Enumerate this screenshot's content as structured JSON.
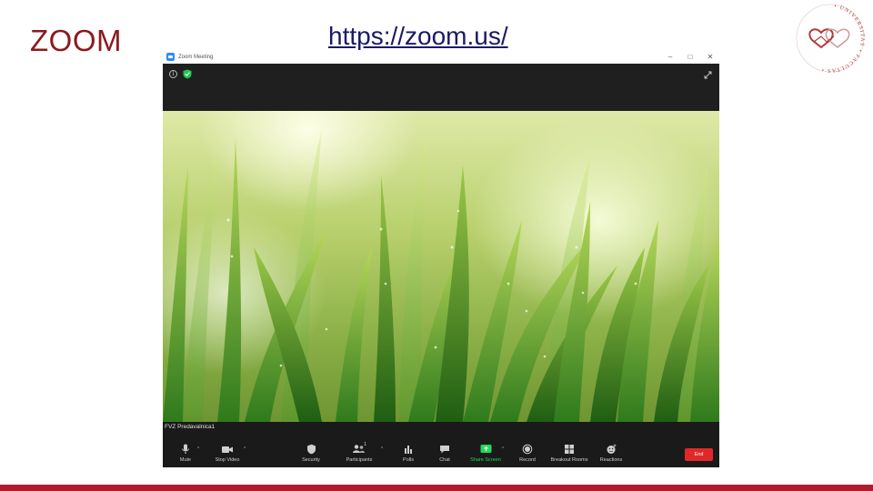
{
  "slide": {
    "title": "ZOOM",
    "link": "https://zoom.us/"
  },
  "window": {
    "title": "Zoom Meeting",
    "controls": [
      "–",
      "□",
      "✕"
    ]
  },
  "participant_name": "FVZ Predavalnica1",
  "toolbar": {
    "mute": "Mute",
    "stop_video": "Stop Video",
    "security": "Security",
    "participants": "Participants",
    "participants_count": "1",
    "polls": "Polls",
    "chat": "Chat",
    "share_screen": "Share Screen",
    "record": "Record",
    "breakout_rooms": "Breakout Rooms",
    "reactions": "Reactions",
    "end": "End"
  },
  "colors": {
    "title_red": "#8b1a1f",
    "link_navy": "#1a1a66",
    "footer_red": "#b01c2e",
    "share_green": "#23d959",
    "end_red": "#e02828",
    "zoom_blue": "#2d8cff"
  },
  "icons": [
    "info-icon",
    "shield-check-icon",
    "fullscreen-icon",
    "microphone-icon",
    "video-camera-icon",
    "security-shield-icon",
    "participants-icon",
    "polls-icon",
    "chat-icon",
    "share-screen-icon",
    "record-icon",
    "breakout-rooms-icon",
    "reactions-icon"
  ]
}
